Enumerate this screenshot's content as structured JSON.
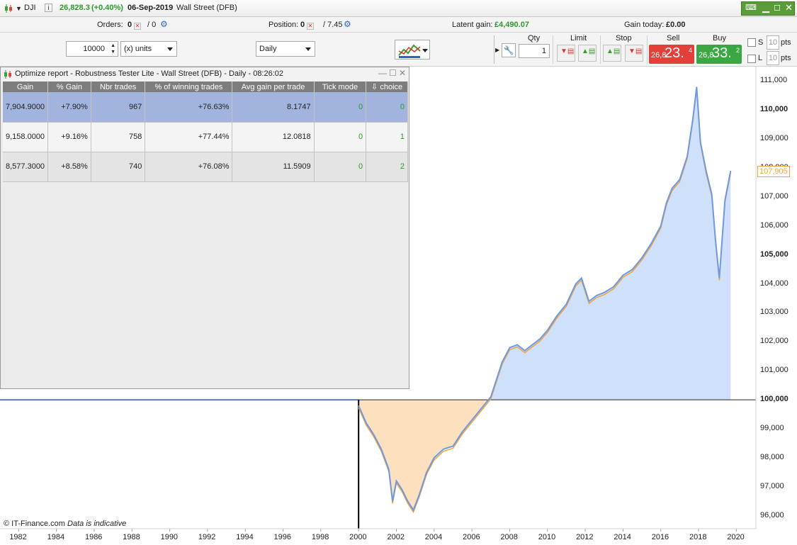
{
  "header": {
    "symbol": "DJI",
    "info_icon": "info-icon",
    "price": "26,828.3",
    "change": "(+0.40%)",
    "date": "06-Sep-2019",
    "market": "Wall Street (DFB)"
  },
  "status": {
    "orders_label": "Orders:",
    "orders_value": "0",
    "orders_sep": "/ 0",
    "position_label": "Position:",
    "position_value": "0",
    "position_sep": "/ 7.45",
    "latent_label": "Latent gain:",
    "latent_value": "£4,490.07",
    "gaintoday_label": "Gain today:",
    "gaintoday_value": "£0.00"
  },
  "toolbar": {
    "quantity_value": "10000",
    "units_select": "(x) units",
    "timeframe_select": "Daily",
    "qty_label": "Qty",
    "qty_value": "1",
    "limit_label": "Limit",
    "stop_label": "Stop",
    "sell_label": "Sell",
    "buy_label": "Buy",
    "sell_small": "26,8",
    "sell_big": "23.",
    "sell_sup": "4",
    "buy_small": "26,8",
    "buy_big": "33.",
    "buy_sup": "2",
    "s_label": "S",
    "l_label": "L",
    "s_pts_value": "10",
    "l_pts_value": "10",
    "pts_label": "pts"
  },
  "optimize": {
    "title": "Optimize report - Robustness Tester Lite - Wall Street (DFB) - Daily - 08:26:02",
    "columns": [
      "Gain",
      "% Gain",
      "Nbr trades",
      "% of winning trades",
      "Avg gain per trade",
      "Tick mode",
      "choice"
    ],
    "rows": [
      [
        "7,904.9000",
        "+7.90%",
        "967",
        "+76.63%",
        "8.1747",
        "0",
        "0"
      ],
      [
        "9,158.0000",
        "+9.16%",
        "758",
        "+77.44%",
        "12.0818",
        "0",
        "1"
      ],
      [
        "8,577.3000",
        "+8.58%",
        "740",
        "+76.08%",
        "11.5909",
        "0",
        "2"
      ]
    ]
  },
  "chart_data": {
    "type": "area",
    "title": "",
    "xlabel": "",
    "ylabel": "",
    "xlim": [
      1981.2,
      2021
    ],
    "ylim": [
      95600,
      111500
    ],
    "baseline": 100000,
    "x_ticks": [
      "1982",
      "1984",
      "1986",
      "1988",
      "1990",
      "1992",
      "1994",
      "1996",
      "1998",
      "2000",
      "2002",
      "2004",
      "2006",
      "2008",
      "2010",
      "2012",
      "2014",
      "2016",
      "2018",
      "2020"
    ],
    "y_ticks": [
      "111,000",
      "110,000",
      "109,000",
      "108,000",
      "107,000",
      "106,000",
      "105,000",
      "104,000",
      "103,000",
      "102,000",
      "101,000",
      "100,000",
      "99,000",
      "98,000",
      "97,000",
      "96,000"
    ],
    "last_value_label": "107,905",
    "colors": {
      "line": "#6d9ae3",
      "spike": "#f2a23a",
      "above_fill": "#cfe0fb",
      "below_fill": "#fde1bf",
      "last_label": "#f2a23a"
    },
    "series": [
      {
        "x": [
          2000.0,
          2000.4,
          2000.8,
          2001.2,
          2001.6,
          2001.8,
          2002.0,
          2002.3,
          2002.6,
          2002.9,
          2003.2,
          2003.6,
          2004.0,
          2004.5,
          2005.0,
          2005.5,
          2006.0,
          2006.5,
          2007.0,
          2007.3,
          2007.6,
          2008.0,
          2008.4,
          2008.8,
          2009.2,
          2009.6,
          2010.0,
          2010.5,
          2011.0,
          2011.5,
          2011.8,
          2012.2,
          2012.6,
          2013.0,
          2013.5,
          2014.0,
          2014.5,
          2015.0,
          2015.5,
          2016.0,
          2016.3,
          2016.6,
          2017.0,
          2017.4,
          2017.7,
          2017.9,
          2018.1,
          2018.4,
          2018.7,
          2018.9,
          2019.1,
          2019.4,
          2019.7
        ],
        "y": [
          99800,
          99200,
          98800,
          98300,
          97600,
          96500,
          97200,
          96900,
          96500,
          96200,
          96700,
          97500,
          98000,
          98300,
          98400,
          98900,
          99300,
          99700,
          100100,
          100700,
          101300,
          101800,
          101900,
          101700,
          101900,
          102100,
          102400,
          102900,
          103300,
          104000,
          104200,
          103400,
          103600,
          103700,
          103900,
          104300,
          104500,
          104900,
          105400,
          106000,
          106800,
          107300,
          107600,
          108400,
          109700,
          110800,
          108900,
          107900,
          107100,
          105500,
          104200,
          106900,
          107905
        ]
      }
    ]
  }
}
